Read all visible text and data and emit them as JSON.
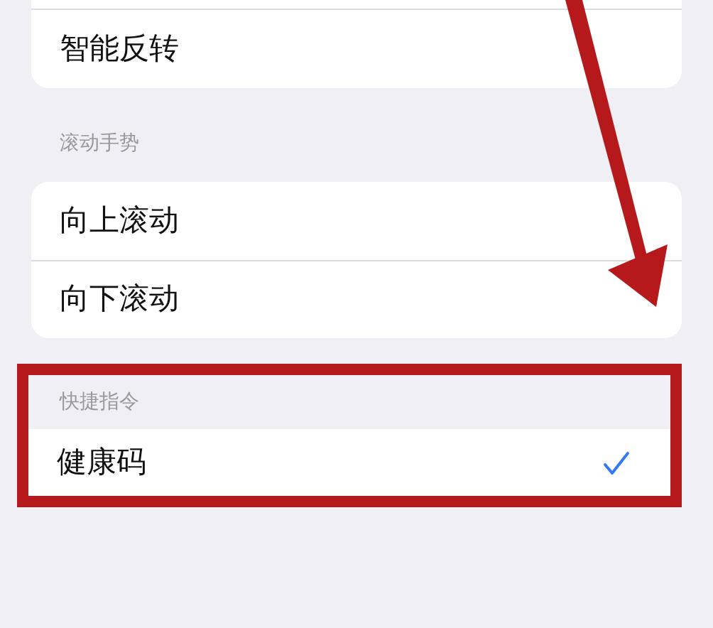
{
  "top_group": {
    "items": [
      {
        "label": "智能反转"
      }
    ]
  },
  "scroll_group": {
    "header": "滚动手势",
    "items": [
      {
        "label": "向上滚动"
      },
      {
        "label": "向下滚动"
      }
    ]
  },
  "shortcuts_group": {
    "header": "快捷指令",
    "items": [
      {
        "label": "健康码",
        "selected": true
      }
    ]
  }
}
